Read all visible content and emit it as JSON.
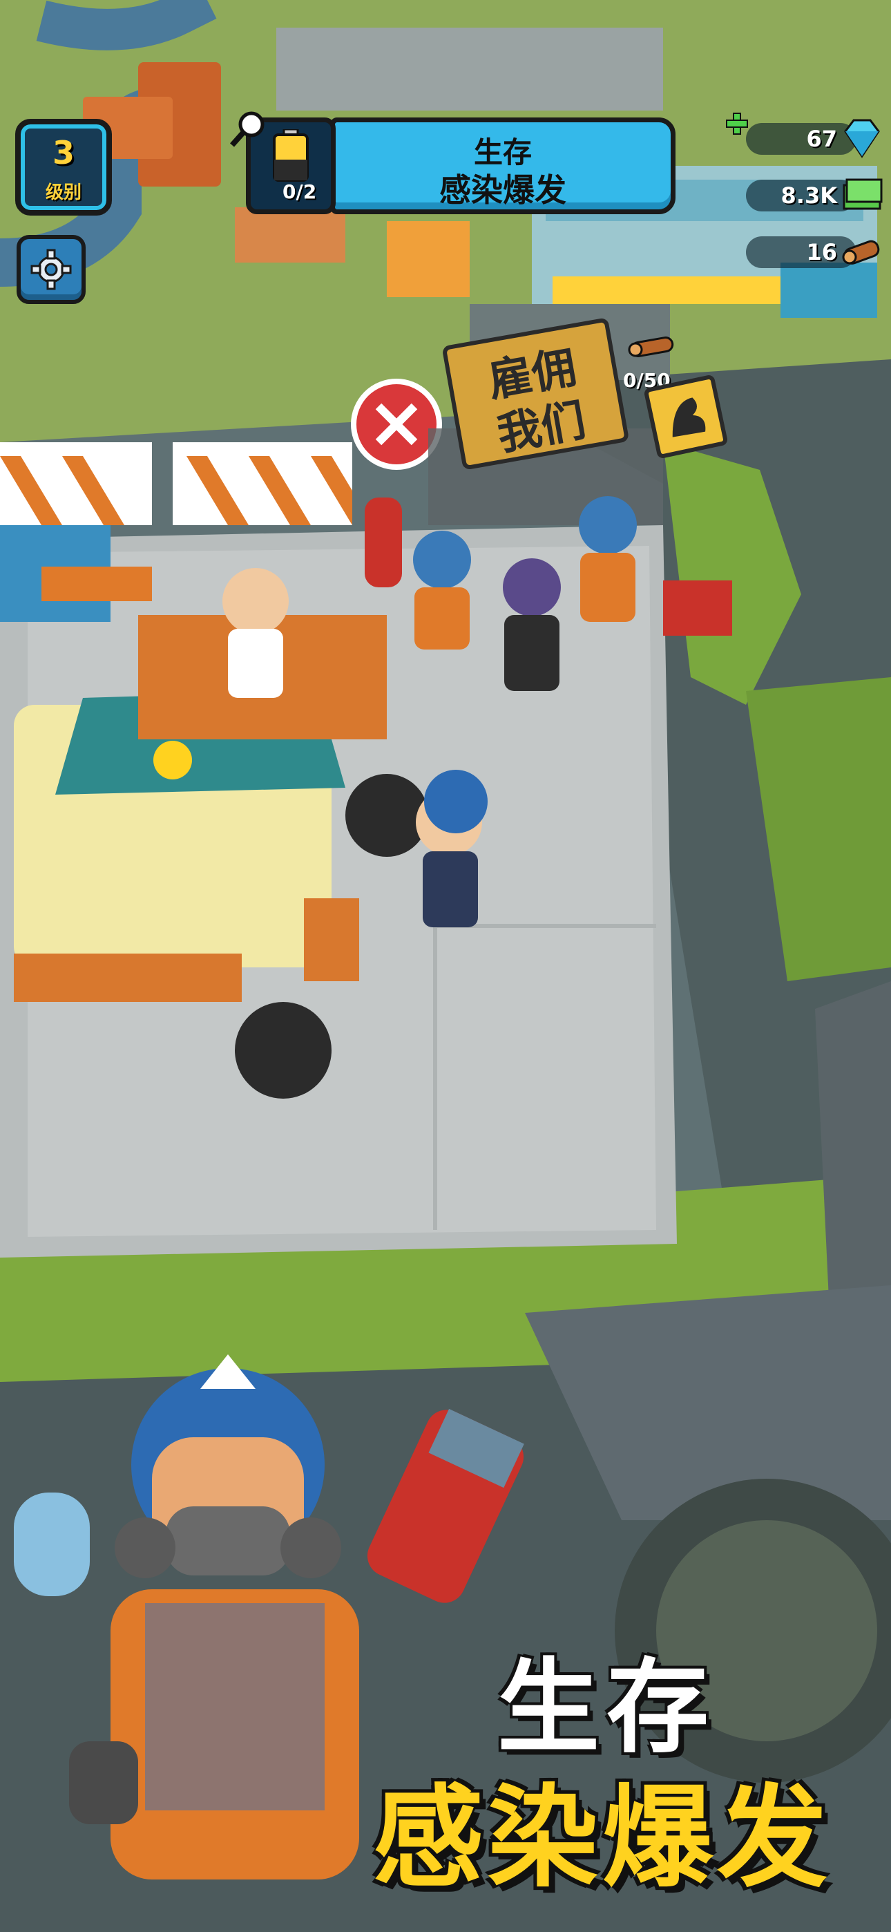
{
  "hud": {
    "level": {
      "number": "3",
      "label": "级别"
    },
    "quest": {
      "title": "生存",
      "subtitle": "感染爆发",
      "progress": "0/2"
    },
    "resources": [
      {
        "name": "gems",
        "value": "67",
        "icon": "gem-icon"
      },
      {
        "name": "cash",
        "value": "8.3K",
        "icon": "cash-icon"
      },
      {
        "name": "wood",
        "value": "16",
        "icon": "wood-icon"
      }
    ]
  },
  "world": {
    "hire_sign": {
      "line1": "雇佣",
      "line2": "我们"
    },
    "wood_requirement": "0/50"
  },
  "promo": {
    "line1": "生存",
    "line2": "感染爆发"
  },
  "colors": {
    "accent_blue": "#34b9ea",
    "title_yellow": "#ffd21f",
    "badge_yellow": "#ffd23a"
  }
}
